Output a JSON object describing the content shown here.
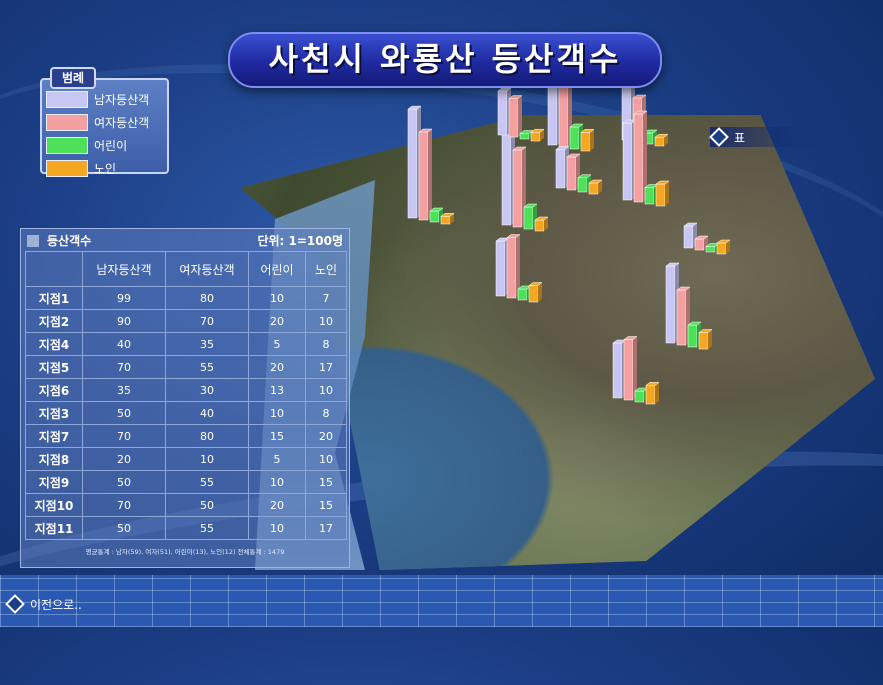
{
  "title": "사천시 와룡산 등산객수",
  "legend": {
    "tag": "범례",
    "items": [
      {
        "label": "남자등산객",
        "color": "#c8c6f2"
      },
      {
        "label": "여자등산객",
        "color": "#f4a0a0"
      },
      {
        "label": "어린이",
        "color": "#4fe05a"
      },
      {
        "label": "노인",
        "color": "#f5a623"
      }
    ]
  },
  "nav": {
    "table_link": "표",
    "back_link": "이전으로.."
  },
  "panel": {
    "title": "등산객수",
    "unit": "단위: 1=100명",
    "columns": [
      "",
      "남자등산객",
      "여자등산객",
      "어린이",
      "노인"
    ],
    "rows": [
      {
        "site": "지점1",
        "values": [
          "99",
          "80",
          "10",
          "7"
        ]
      },
      {
        "site": "지점2",
        "values": [
          "90",
          "70",
          "20",
          "10"
        ]
      },
      {
        "site": "지점4",
        "values": [
          "40",
          "35",
          "5",
          "8"
        ]
      },
      {
        "site": "지점5",
        "values": [
          "70",
          "55",
          "20",
          "17"
        ]
      },
      {
        "site": "지점6",
        "values": [
          "35",
          "30",
          "13",
          "10"
        ]
      },
      {
        "site": "지점3",
        "values": [
          "50",
          "40",
          "10",
          "8"
        ]
      },
      {
        "site": "지점7",
        "values": [
          "70",
          "80",
          "15",
          "20"
        ]
      },
      {
        "site": "지점8",
        "values": [
          "20",
          "10",
          "5",
          "10"
        ]
      },
      {
        "site": "지점9",
        "values": [
          "50",
          "55",
          "10",
          "15"
        ]
      },
      {
        "site": "지점10",
        "values": [
          "70",
          "50",
          "20",
          "15"
        ]
      },
      {
        "site": "지점11",
        "values": [
          "50",
          "55",
          "10",
          "17"
        ]
      }
    ],
    "footnote": "평균통계 : 남자(59), 여자(51), 어린이(13), 노인(12)    전체통계 : 1479"
  }
}
